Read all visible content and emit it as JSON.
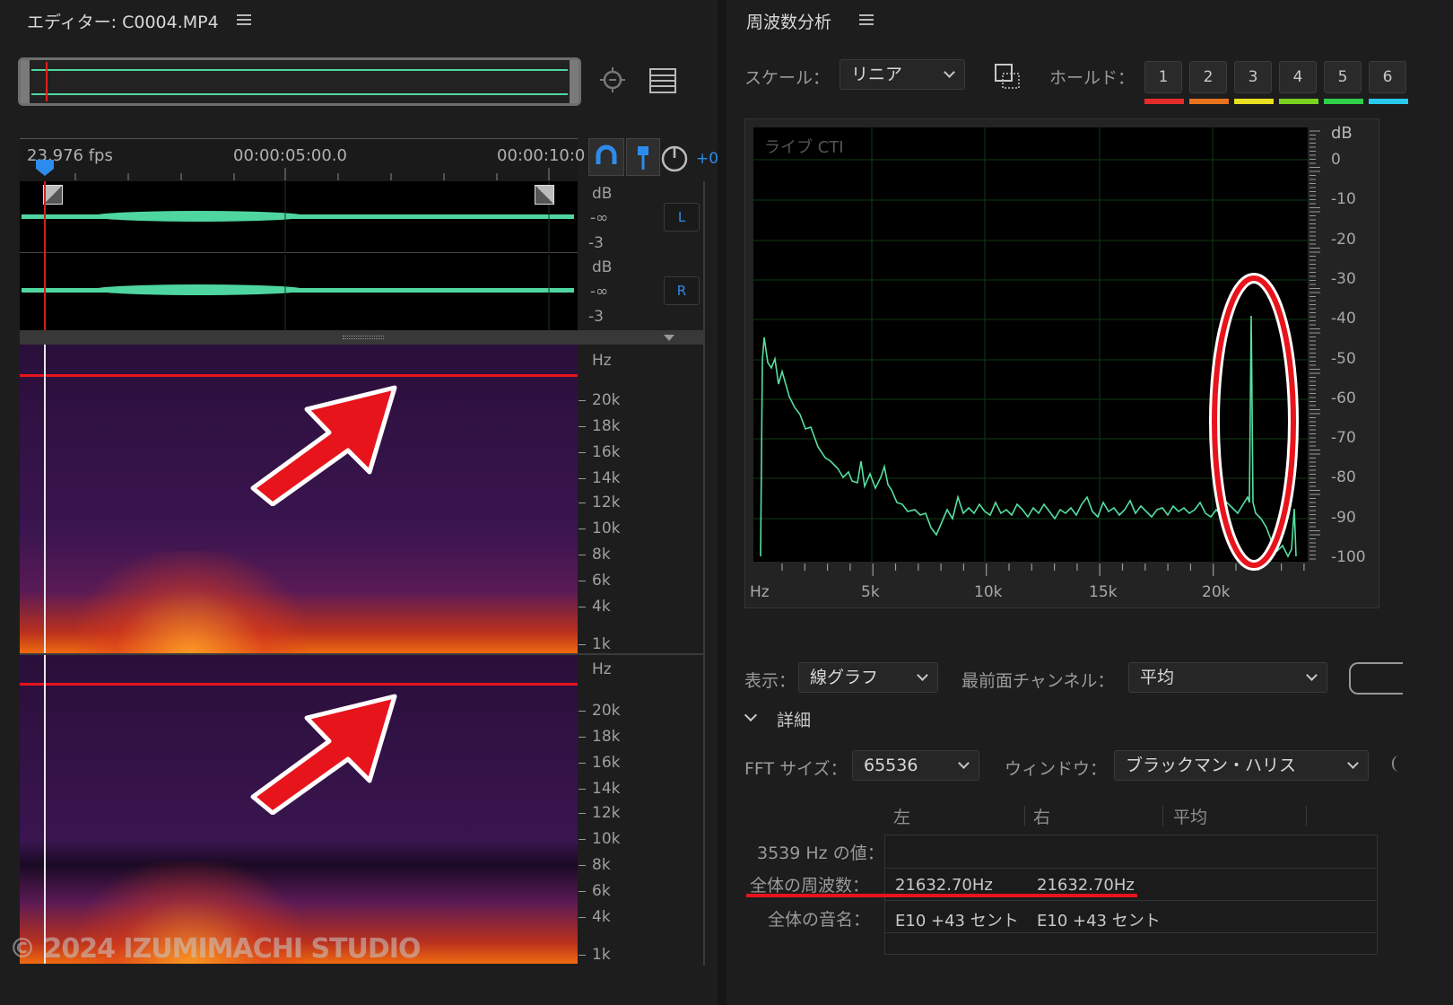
{
  "editor": {
    "title": "エディター: C0004.MP4",
    "fps": "23.976 fps",
    "time_5": "00:00:05:00.0",
    "time_10": "00:00:10:0",
    "offset": "+0",
    "db_label": "dB",
    "neg_inf": "-∞",
    "minus3": "-3",
    "channel_l": "L",
    "channel_r": "R",
    "hz_label": "Hz",
    "hz_ticks": [
      "20k",
      "18k",
      "16k",
      "14k",
      "12k",
      "10k",
      "8k",
      "6k",
      "4k",
      "1k"
    ],
    "watermark": "© 2024 IZUMIMACHI STUDIO"
  },
  "freq": {
    "title": "周波数分析",
    "scale_label": "スケール：",
    "scale_value": "リニア",
    "hold_label": "ホールド：",
    "hold_buttons": [
      "1",
      "2",
      "3",
      "4",
      "5",
      "6"
    ],
    "hold_colors": [
      "#e52b2b",
      "#e8731d",
      "#e8e020",
      "#7ad21e",
      "#2fcf4a",
      "#27c9ee"
    ],
    "live_label": "ライブ CTI",
    "db_axis_title": "dB",
    "db_ticks": [
      "0",
      "-10",
      "-20",
      "-30",
      "-40",
      "-50",
      "-60",
      "-70",
      "-80",
      "-90",
      "-100"
    ],
    "hz_axis": [
      "Hz",
      "5k",
      "10k",
      "15k",
      "20k"
    ],
    "display_label": "表示：",
    "display_value": "線グラフ",
    "front_label": "最前面チャンネル：",
    "front_value": "平均",
    "details_label": "詳細",
    "fft_label": "FFT サイズ：",
    "fft_value": "65536",
    "window_label": "ウィンドウ：",
    "window_value": "ブラックマン・ハリス",
    "col_left": "左",
    "col_right": "右",
    "col_avg": "平均",
    "row1_label": "3539 Hz の値：",
    "row2_label": "全体の周波数：",
    "row2_left": "21632.70Hz",
    "row2_right": "21632.70Hz",
    "row3_label": "全体の音名：",
    "row3_left": "E10 +43 セント",
    "row3_right": "E10 +43 セント"
  },
  "colors": {
    "waveform": "#4fd6a0",
    "spectrum_line": "#55e0a0",
    "annotation_red": "#e8141c",
    "accent_blue": "#2d8ceb"
  }
}
